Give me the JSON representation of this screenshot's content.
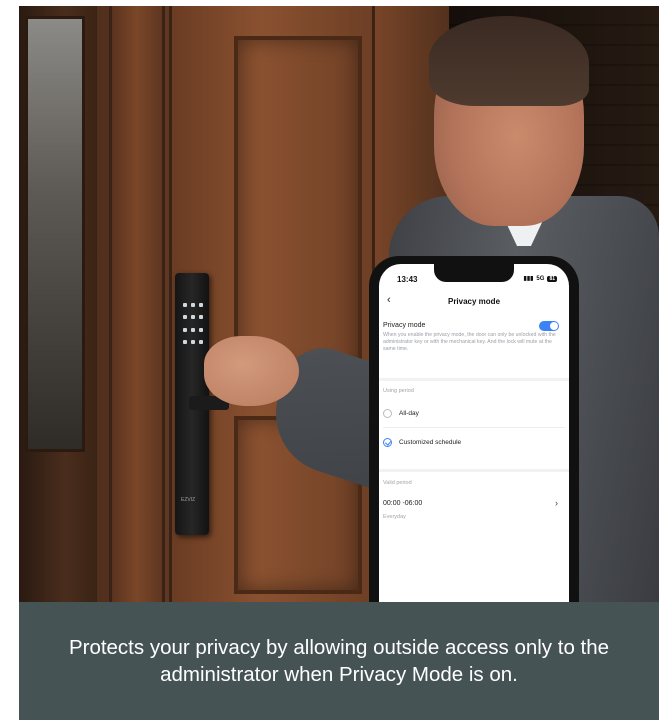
{
  "phone": {
    "status": {
      "time": "13:43",
      "network": "5G",
      "battery": "81"
    },
    "nav": {
      "title": "Privacy mode"
    },
    "privacy": {
      "title": "Privacy mode",
      "enabled": true,
      "description": "When you enable the privacy mode, the door can only be unlocked with the administrator key or with the mechanical key. And the lock will mute at the same time."
    },
    "using_period": {
      "label": "Using period",
      "options": [
        {
          "label": "All-day",
          "selected": false
        },
        {
          "label": "Customized schedule",
          "selected": true
        }
      ]
    },
    "valid_period": {
      "label": "Valid period",
      "time_range": "00:00 -06:00",
      "repeat": "Everyday"
    }
  },
  "lock": {
    "brand": "EZVIZ"
  },
  "caption": {
    "text": "Protects your privacy by allowing outside access only to the administrator when Privacy Mode is on."
  },
  "colors": {
    "caption_bg": "#455355",
    "accent": "#3b82f6"
  }
}
